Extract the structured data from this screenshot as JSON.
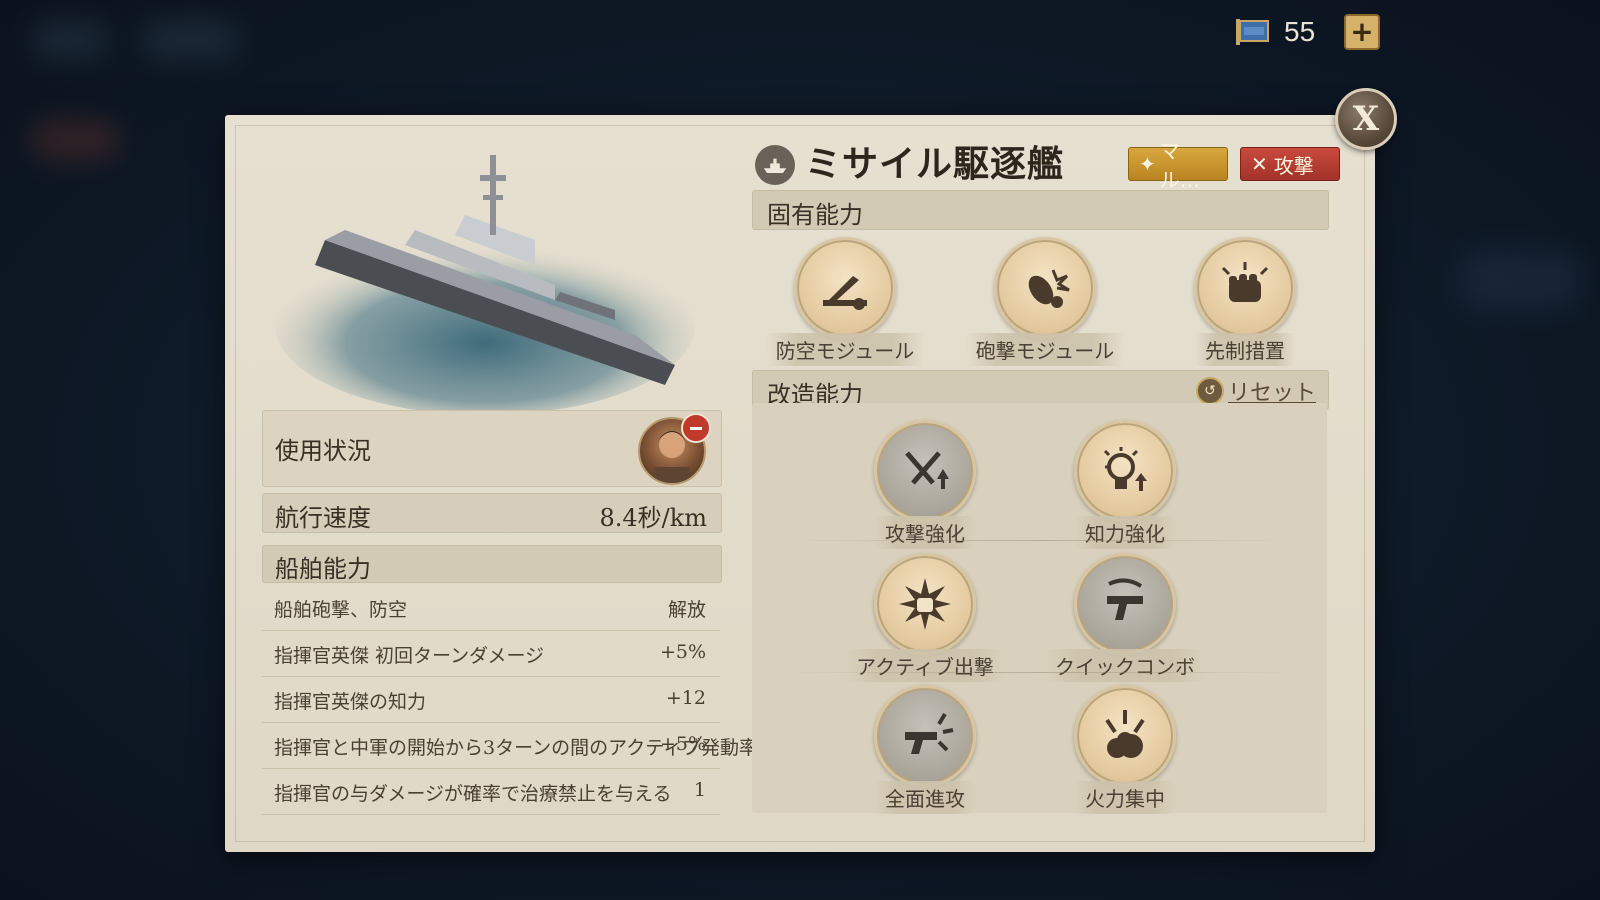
{
  "resources": {
    "count": "55",
    "flag_icon": "flag-icon",
    "plus_label": "+"
  },
  "close_label": "X",
  "ship": {
    "title": "ミサイル駆逐艦",
    "type_icon": "ship-icon",
    "tags": [
      {
        "label": "マル…",
        "icon": "gear-icon",
        "color": "#d9a73f"
      },
      {
        "label": "攻撃",
        "icon": "crossed-swords-icon",
        "color": "#c94a3c"
      }
    ]
  },
  "usage": {
    "label": "使用状況"
  },
  "speed": {
    "label": "航行速度",
    "value": "8.4秒/km"
  },
  "ship_abilities": {
    "header": "船舶能力",
    "rows": [
      {
        "name": "船舶砲撃、防空",
        "value": "解放"
      },
      {
        "name": "指揮官英傑 初回ターンダメージ",
        "value": "+5%"
      },
      {
        "name": "指揮官英傑の知力",
        "value": "+12"
      },
      {
        "name": "指揮官と中軍の開始から3ターンの間のアクティブ発動率",
        "value": "+5%"
      },
      {
        "name": "指揮官の与ダメージが確率で治療禁止を与える",
        "value": "1"
      }
    ]
  },
  "innate": {
    "header": "固有能力",
    "skills": [
      {
        "label": "防空モジュール",
        "icon": "anti-air-missile-icon"
      },
      {
        "label": "砲撃モジュール",
        "icon": "shell-burst-icon"
      },
      {
        "label": "先制措置",
        "icon": "fist-icon"
      }
    ]
  },
  "mod": {
    "header": "改造能力",
    "reset_label": "リセット",
    "skills": [
      {
        "label": "攻撃強化",
        "icon": "swords-up-icon",
        "state": "locked"
      },
      {
        "label": "知力強化",
        "icon": "lightbulb-up-icon",
        "state": "active"
      },
      {
        "label": "アクティブ出撃",
        "icon": "fist-burst-icon",
        "state": "active"
      },
      {
        "label": "クイックコンボ",
        "icon": "pistol-icon",
        "state": "locked"
      },
      {
        "label": "全面進攻",
        "icon": "gun-burst-icon",
        "state": "locked"
      },
      {
        "label": "火力集中",
        "icon": "explosion-icon",
        "state": "active"
      }
    ]
  }
}
